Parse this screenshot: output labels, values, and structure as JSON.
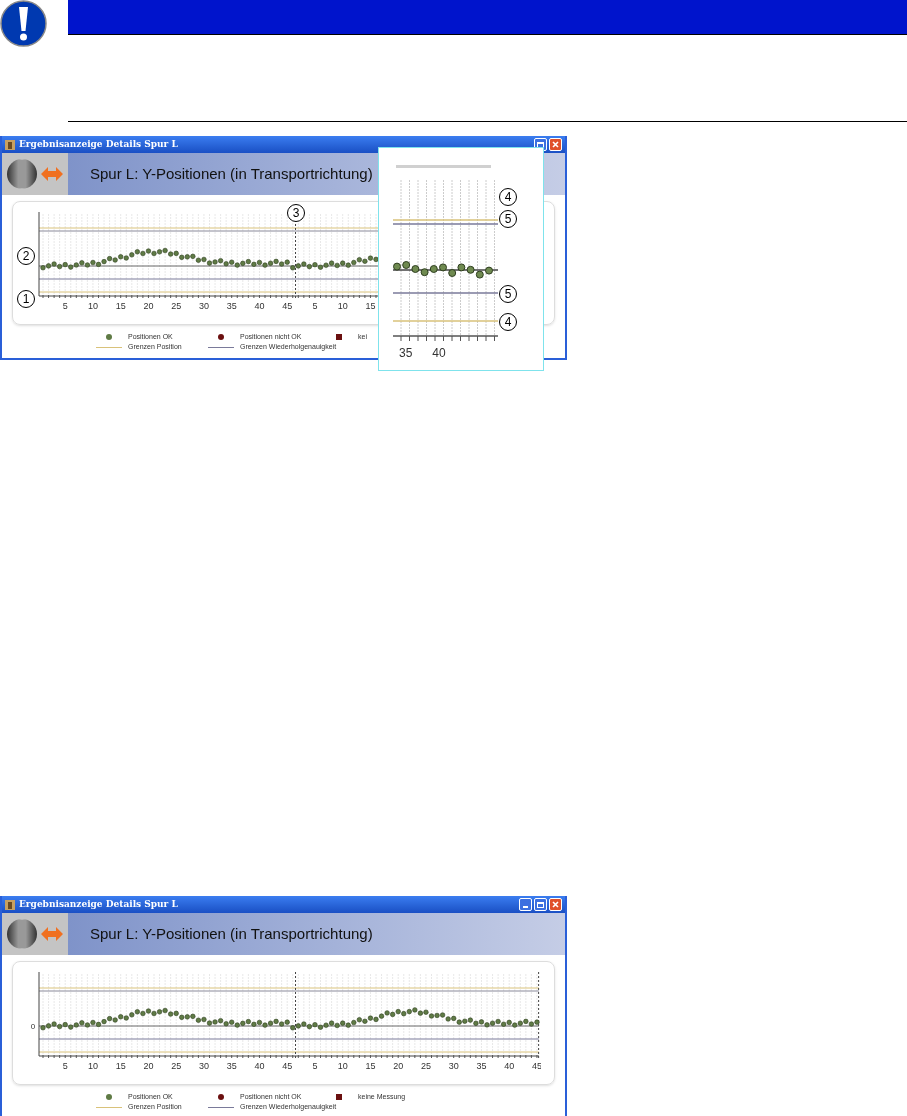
{
  "screenshots": [
    {
      "window_title": "Ergebnisanzeige Details Spur L",
      "header_title": "Spur L: Y-Positionen (in Transportrichtung)",
      "chart": {
        "x_labels": [
          "5",
          "10",
          "15",
          "20",
          "25",
          "30",
          "35",
          "40",
          "45",
          "5",
          "10",
          "15"
        ],
        "callouts": [
          {
            "label": "1"
          },
          {
            "label": "2"
          },
          {
            "label": "3"
          }
        ]
      },
      "legend": [
        {
          "label": "Positionen OK",
          "kind": "dot",
          "color": "#5f7a45"
        },
        {
          "label": "Positionen nicht OK",
          "kind": "dot",
          "color": "#6b1010"
        },
        {
          "label": "kei",
          "kind": "square",
          "color": "#6b1010"
        },
        {
          "label": "Grenzen Position",
          "kind": "line",
          "color": "#d9c27a"
        },
        {
          "label": "Grenzen Wiederholgenauigkeit",
          "kind": "line",
          "color": "#7a7a9a"
        }
      ],
      "inset": {
        "x_labels": [
          "35",
          "40"
        ],
        "callouts": [
          {
            "label": "4"
          },
          {
            "label": "5"
          },
          {
            "label": "5"
          },
          {
            "label": "4"
          }
        ]
      }
    },
    {
      "window_title": "Ergebnisanzeige Details Spur L",
      "header_title": "Spur L: Y-Positionen (in Transportrichtung)",
      "chart": {
        "y_label": "0",
        "x_labels": [
          "5",
          "10",
          "15",
          "20",
          "25",
          "30",
          "35",
          "40",
          "45",
          "5",
          "10",
          "15",
          "20",
          "25",
          "30",
          "35",
          "40",
          "45"
        ]
      },
      "legend": [
        {
          "label": "Positionen OK",
          "kind": "dot",
          "color": "#5f7a45"
        },
        {
          "label": "Positionen nicht OK",
          "kind": "dot",
          "color": "#6b1010"
        },
        {
          "label": "keine Messung",
          "kind": "square",
          "color": "#6b1010"
        },
        {
          "label": "Grenzen Position",
          "kind": "line",
          "color": "#d9c27a"
        },
        {
          "label": "Grenzen Wiederholgenauigkeit",
          "kind": "line",
          "color": "#7a7a9a"
        }
      ]
    }
  ]
}
